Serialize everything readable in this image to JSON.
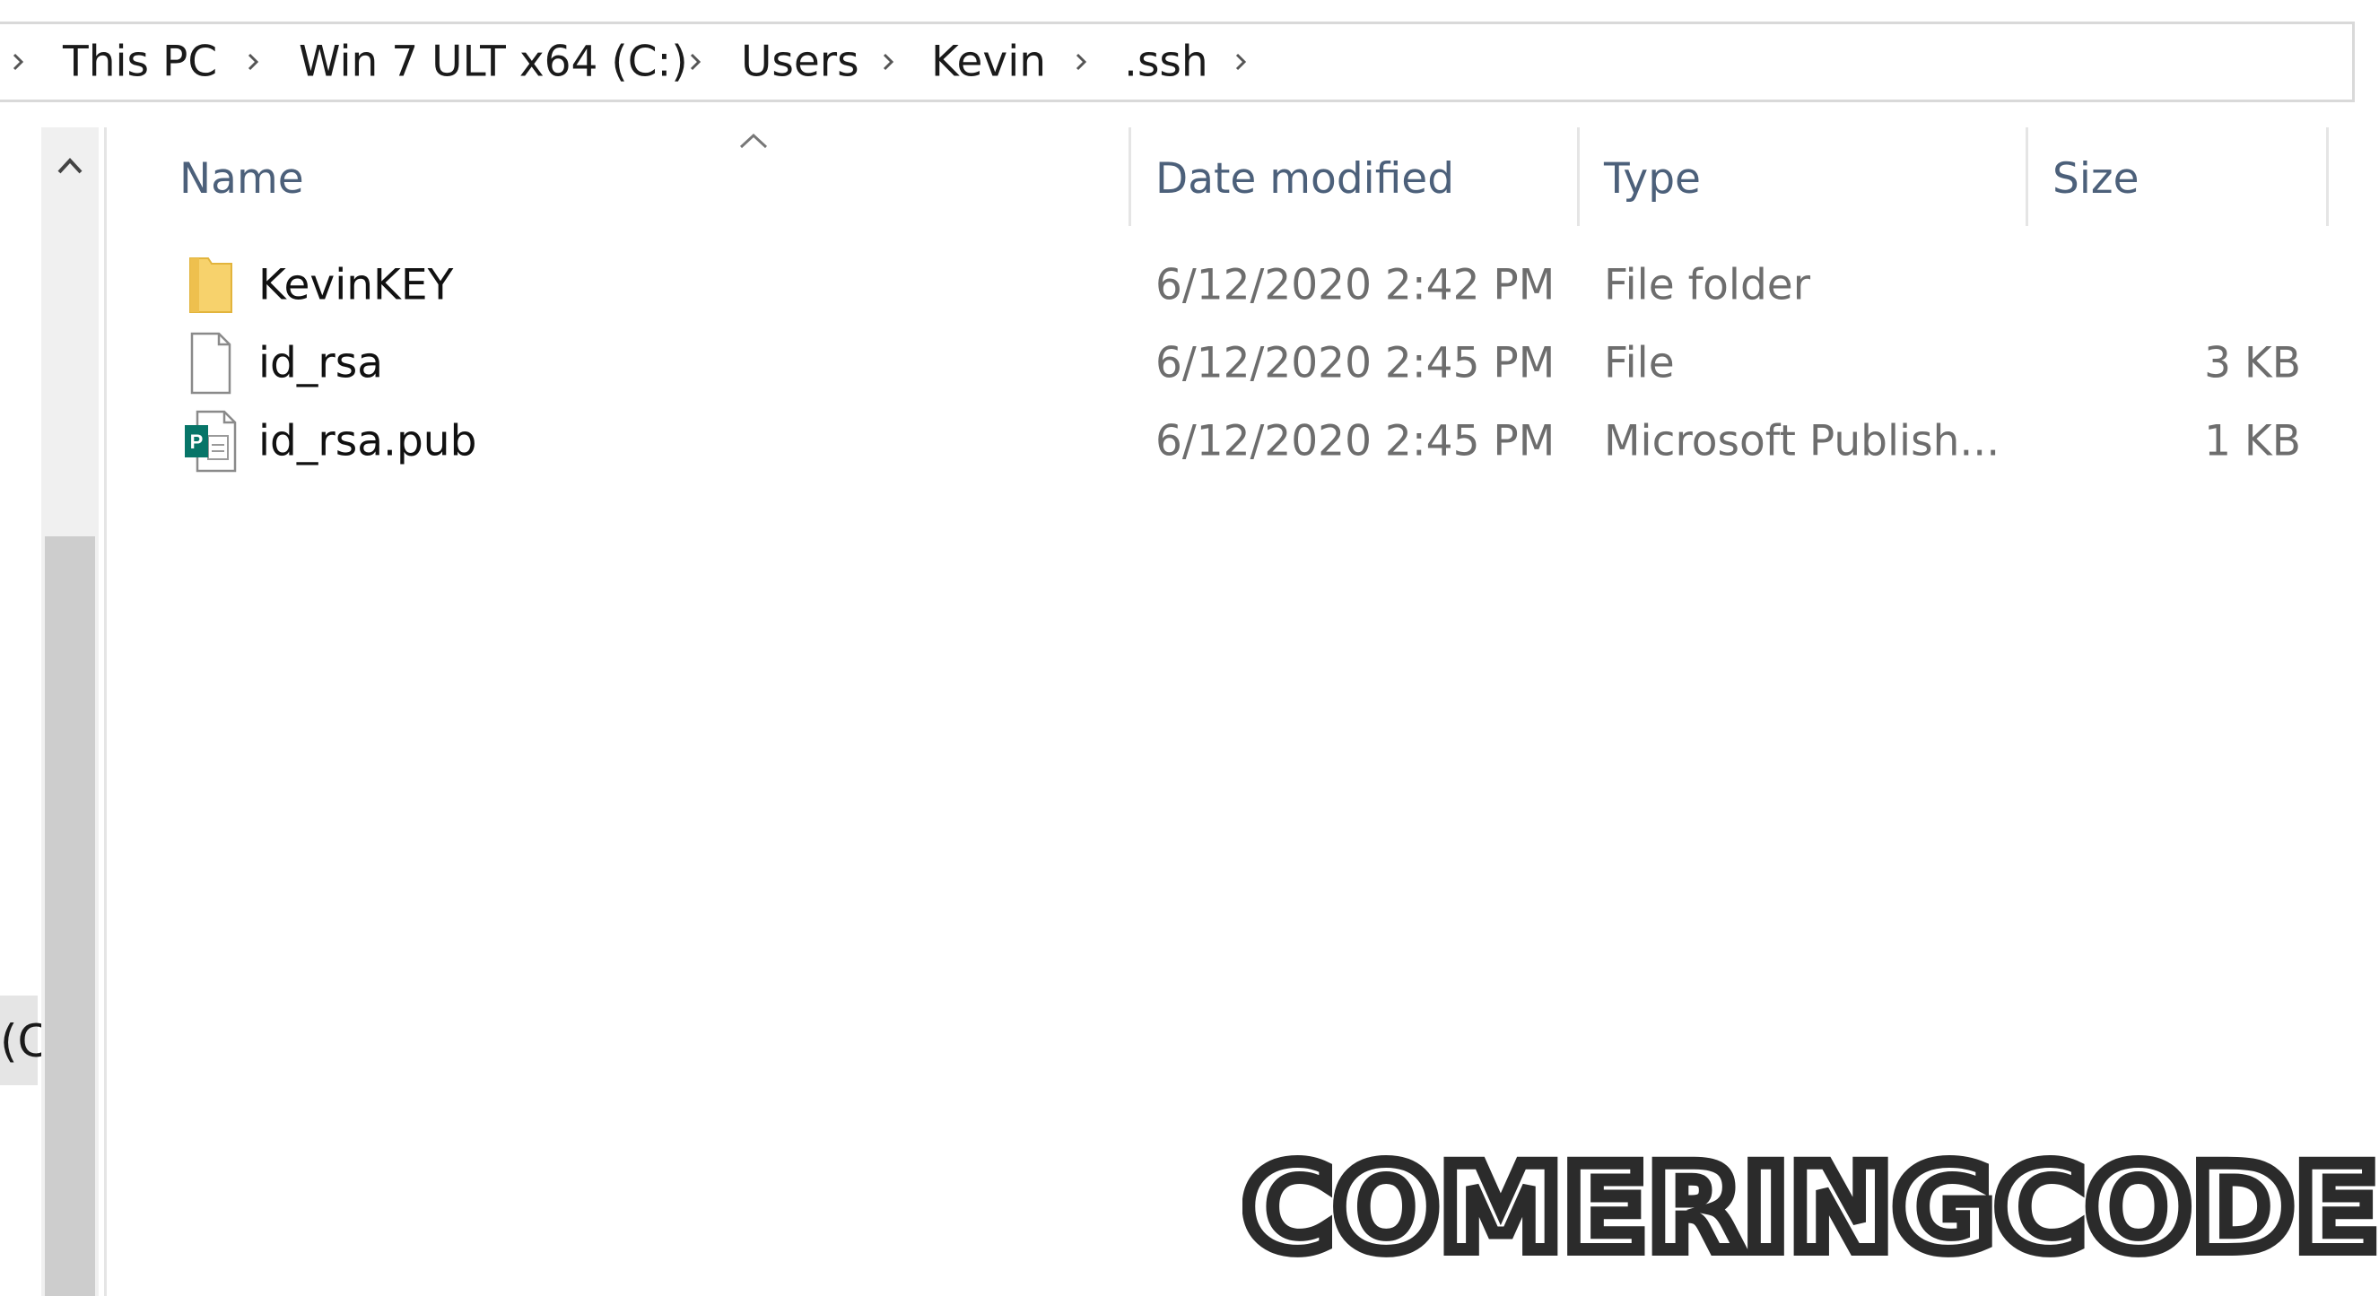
{
  "breadcrumb": {
    "items": [
      {
        "label": "This PC"
      },
      {
        "label": "Win 7 ULT x64 (C:)"
      },
      {
        "label": "Users"
      },
      {
        "label": "Kevin"
      },
      {
        "label": ".ssh"
      }
    ]
  },
  "nav_pane": {
    "cut_off_text": "(C"
  },
  "columns": {
    "name": "Name",
    "date_modified": "Date modified",
    "type": "Type",
    "size": "Size"
  },
  "files": [
    {
      "name": "KevinKEY",
      "date": "6/12/2020 2:42 PM",
      "type": "File folder",
      "size": "",
      "icon": "folder-icon"
    },
    {
      "name": "id_rsa",
      "date": "6/12/2020 2:45 PM",
      "type": "File",
      "size": "3 KB",
      "icon": "blank-file-icon"
    },
    {
      "name": "id_rsa.pub",
      "date": "6/12/2020 2:45 PM",
      "type": "Microsoft Publish...",
      "size": "1 KB",
      "icon": "publisher-file-icon"
    }
  ],
  "watermark": {
    "text": "COMERINGCODE"
  },
  "colors": {
    "header_text": "#4c607a",
    "folder_yellow": "#f7d26c",
    "publisher_green": "#077568",
    "scroll_thumb": "#cdcdcd"
  }
}
